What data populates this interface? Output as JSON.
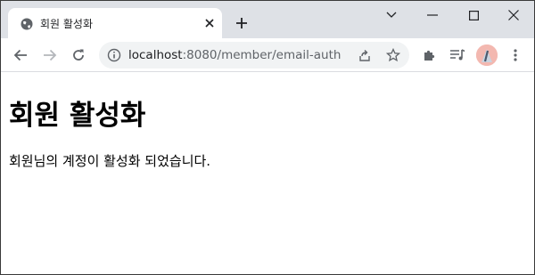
{
  "browser": {
    "tab": {
      "title": "회원 활성화",
      "favicon": "globe-icon"
    },
    "address": {
      "host": "localhost",
      "path": ":8080/member/email-auth"
    }
  },
  "page": {
    "heading": "회원 활성화",
    "message": "회원님의 계정이 활성화 되었습니다."
  },
  "colors": {
    "tab_strip": "#dee1e6",
    "omnibox": "#f1f3f4",
    "avatar": "#f3b8b0"
  }
}
